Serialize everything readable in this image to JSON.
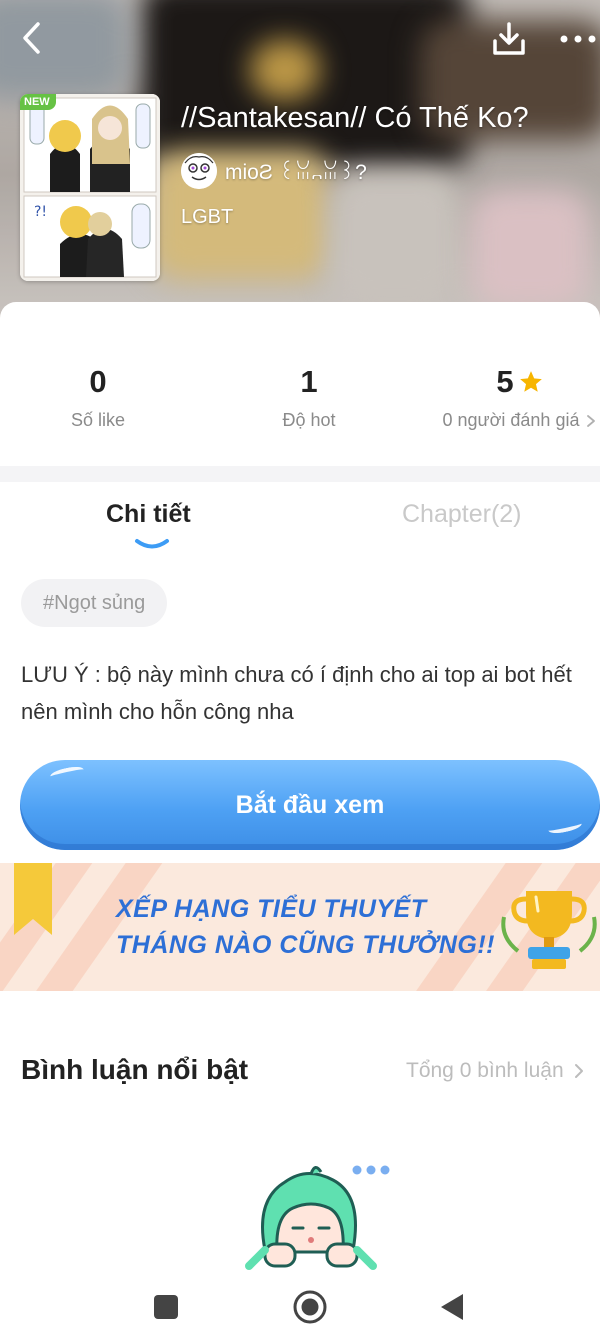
{
  "header": {
    "title": "//Santakesan// Có Thế Ko?",
    "author_name": "mioƧ ꒰ꈍ᎔ꈍ꒱?",
    "genre": "LGBT",
    "new_badge": "NEW"
  },
  "stats": [
    {
      "value": "0",
      "label": "Số like"
    },
    {
      "value": "1",
      "label": "Độ hot"
    },
    {
      "value": "5",
      "label": "0 người đánh giá"
    }
  ],
  "tabs": {
    "detail": "Chi tiết",
    "chapter": "Chapter(2)"
  },
  "tag": "#Ngọt sủng",
  "description": "LƯU Ý : bộ này mình chưa có í định cho ai top ai bot hết nên mình cho hỗn công nha",
  "start_button": "Bắt đầu xem",
  "banner": {
    "line1": "XẾP HẠNG TIỂU THUYẾT",
    "line2": "THÁNG NÀO CŨNG THƯỞNG!!"
  },
  "comments": {
    "title": "Bình luận nổi bật",
    "total": "Tổng 0 bình luận"
  },
  "colors": {
    "accent_blue": "#4ea1f4",
    "star_yellow": "#f7b500",
    "new_green": "#66c244",
    "banner_text": "#2d6fd6",
    "mascot_hair": "#5fe0b0"
  }
}
